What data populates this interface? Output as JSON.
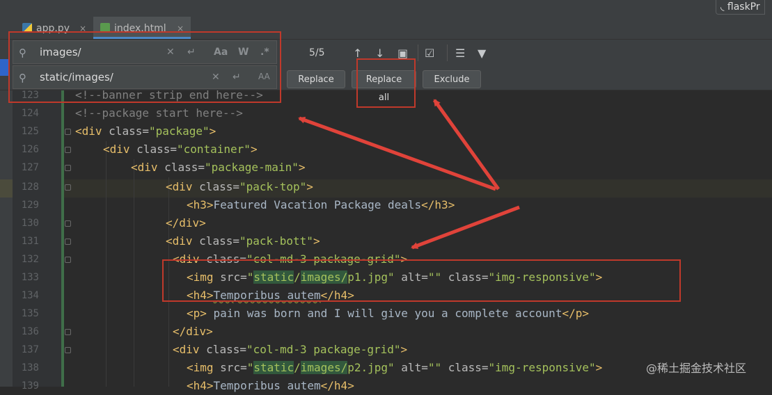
{
  "project_tab": "flaskPr",
  "tabs": [
    {
      "label": "app.py",
      "close": "×"
    },
    {
      "label": "index.html",
      "close": "×"
    }
  ],
  "find": {
    "search_value": "images/",
    "replace_value": "static/images/",
    "match_count": "5/5",
    "match_case_label": "Aa",
    "whole_word_label": "W",
    "regex_label": ".*",
    "preserve_case_label": "AA"
  },
  "buttons": {
    "replace": "Replace",
    "replace_all": "Replace all",
    "exclude": "Exclude"
  },
  "lines": [
    {
      "n": "123",
      "text": "<!--banner strip end here-->"
    },
    {
      "n": "124",
      "text": "<!--package start here-->"
    },
    {
      "n": "125",
      "text": "<div class=\"package\">"
    },
    {
      "n": "126",
      "text": "<div class=\"container\">"
    },
    {
      "n": "127",
      "text": "<div class=\"package-main\">"
    },
    {
      "n": "128",
      "text": "<div class=\"pack-top\">"
    },
    {
      "n": "129",
      "text": "<h3>Featured Vacation Package deals</h3>"
    },
    {
      "n": "130",
      "text": "</div>"
    },
    {
      "n": "131",
      "text": "<div class=\"pack-bott\">"
    },
    {
      "n": "132",
      "text": "<div class=\"col-md-3 package-grid\">"
    },
    {
      "n": "133",
      "text": "<img src=\"static/images/p1.jpg\" alt=\"\" class=\"img-responsive\">"
    },
    {
      "n": "134",
      "text": "<h4>Temporibus autem</h4>"
    },
    {
      "n": "135",
      "text": "<p> pain was born and I will give you a complete account</p>"
    },
    {
      "n": "136",
      "text": "</div>"
    },
    {
      "n": "137",
      "text": "<div class=\"col-md-3 package-grid\">"
    },
    {
      "n": "138",
      "text": "<img src=\"static/images/p2.jpg\" alt=\"\" class=\"img-responsive\">"
    },
    {
      "n": "139",
      "text": "<h4>Temporibus autem</h4>"
    }
  ],
  "watermark": "@稀土掘金技术社区",
  "colors": {
    "annotation": "#c0392b",
    "accent": "#4a88c7",
    "match_highlight": "#32593d"
  }
}
